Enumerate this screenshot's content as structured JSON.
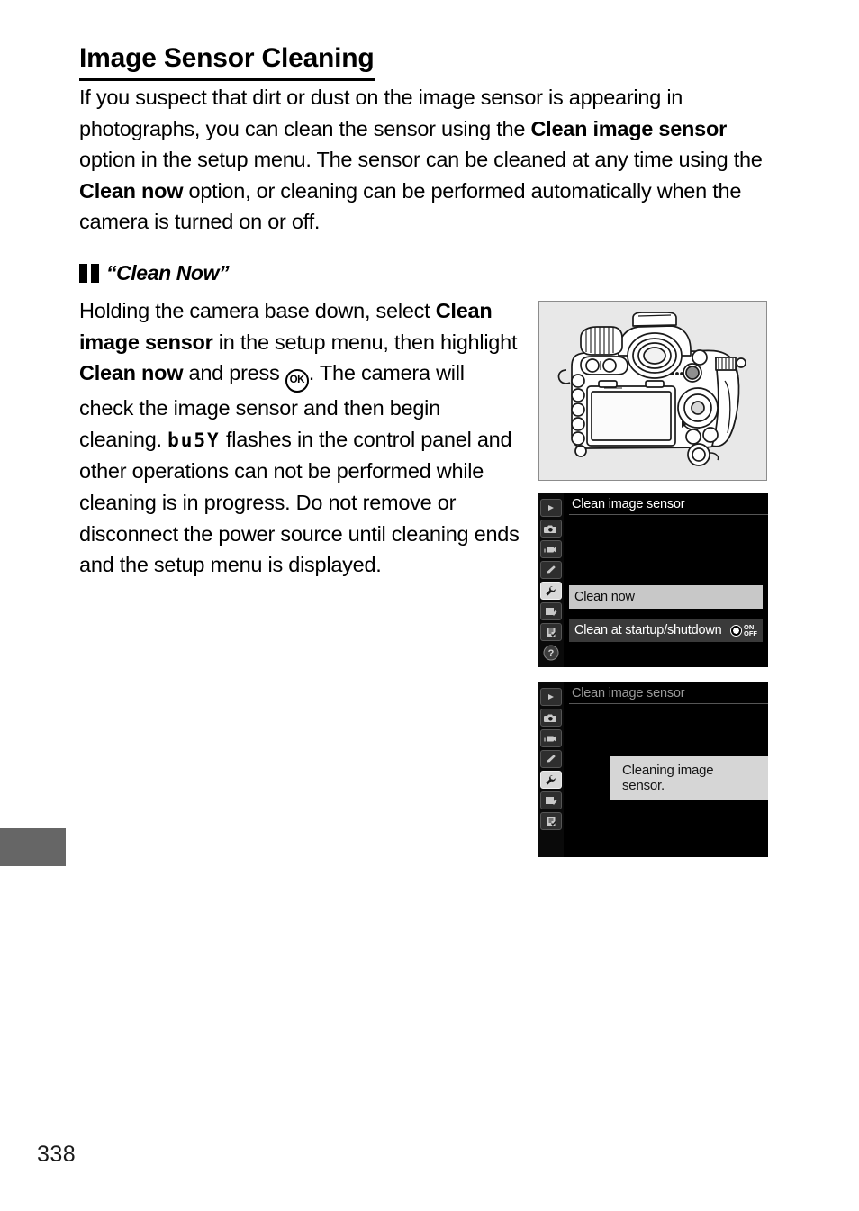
{
  "page": {
    "number": "338",
    "title": "Image Sensor Cleaning"
  },
  "intro": {
    "part1": "If you suspect that dirt or dust on the image sensor is appearing in photographs, you can clean the sensor using the ",
    "bold1": "Clean image sensor",
    "part2": " option in the setup menu.  The sensor can be cleaned at any time using the ",
    "bold2": "Clean now",
    "part3": " option, or cleaning can be performed automatically when the camera is turned on or off."
  },
  "section": {
    "icon_name": "two-bars-icon",
    "heading": "“Clean Now”",
    "body_part1": "Holding the camera base down, select ",
    "body_bold1": "Clean image sensor",
    "body_part2": " in the setup menu, then highlight ",
    "body_bold2": "Clean now",
    "body_part3": " and press ",
    "ok_glyph": "OK",
    "body_part4": ".  The camera will check the image sensor and then begin cleaning.  ",
    "lcd_glyph": "bu5Y",
    "body_part5": " flashes in the control panel and other operations can not be performed while cleaning is in progress.  Do not remove or disconnect the power source until cleaning ends and the setup menu is displayed."
  },
  "figures": {
    "camera_illustration": {
      "name": "dslr-camera-rear-illustration",
      "background": "#e8e8e8",
      "border_color": "#8c8c8c"
    },
    "menu_screen_1": {
      "title": "Clean image sensor",
      "rows": [
        {
          "label": "Clean now",
          "selected": true
        },
        {
          "label": "Clean at startup/shutdown",
          "selected": false,
          "badge_on": "ON",
          "badge_off": "OFF"
        }
      ],
      "sidebar_icons": [
        "playback-icon",
        "photo-shooting-menu-icon",
        "movie-shooting-menu-icon",
        "custom-settings-pencil-icon",
        "setup-menu-wrench-icon",
        "retouch-menu-icon",
        "recent-settings-icon",
        "help-question-icon"
      ],
      "active_sidebar_index": 4,
      "highlight_color": "#c8c8c8",
      "row_color": "#3a3a3a"
    },
    "menu_screen_2": {
      "title": "Clean image sensor",
      "dialog_text": "Cleaning image sensor.",
      "sidebar_icons": [
        "playback-icon",
        "photo-shooting-menu-icon",
        "movie-shooting-menu-icon",
        "custom-settings-pencil-icon",
        "setup-menu-wrench-icon",
        "retouch-menu-icon",
        "recent-settings-icon"
      ],
      "active_sidebar_index": 4,
      "dialog_color": "#d6d6d6"
    }
  },
  "thumb_tab": {
    "name": "chapter-thumb-tab",
    "color": "#666666"
  }
}
